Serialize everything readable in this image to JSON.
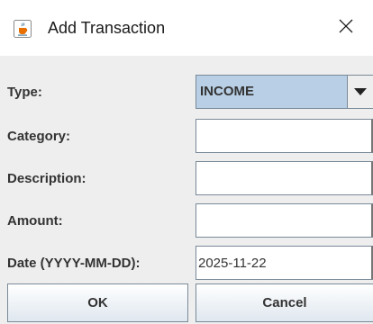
{
  "window": {
    "title": "Add Transaction",
    "app_icon": "java-cup-icon",
    "close_icon": "close-icon"
  },
  "form": {
    "type": {
      "label": "Type:",
      "selected": "INCOME"
    },
    "category": {
      "label": "Category:",
      "value": ""
    },
    "description": {
      "label": "Description:",
      "value": ""
    },
    "amount": {
      "label": "Amount:",
      "value": ""
    },
    "date": {
      "label": "Date (YYYY-MM-DD):",
      "value": "2025-11-22"
    }
  },
  "buttons": {
    "ok_label": "OK",
    "cancel_label": "Cancel"
  },
  "colors": {
    "combo_selected_bg": "#b8cfe5",
    "border": "#7a8a99",
    "label_text": "#333333"
  }
}
